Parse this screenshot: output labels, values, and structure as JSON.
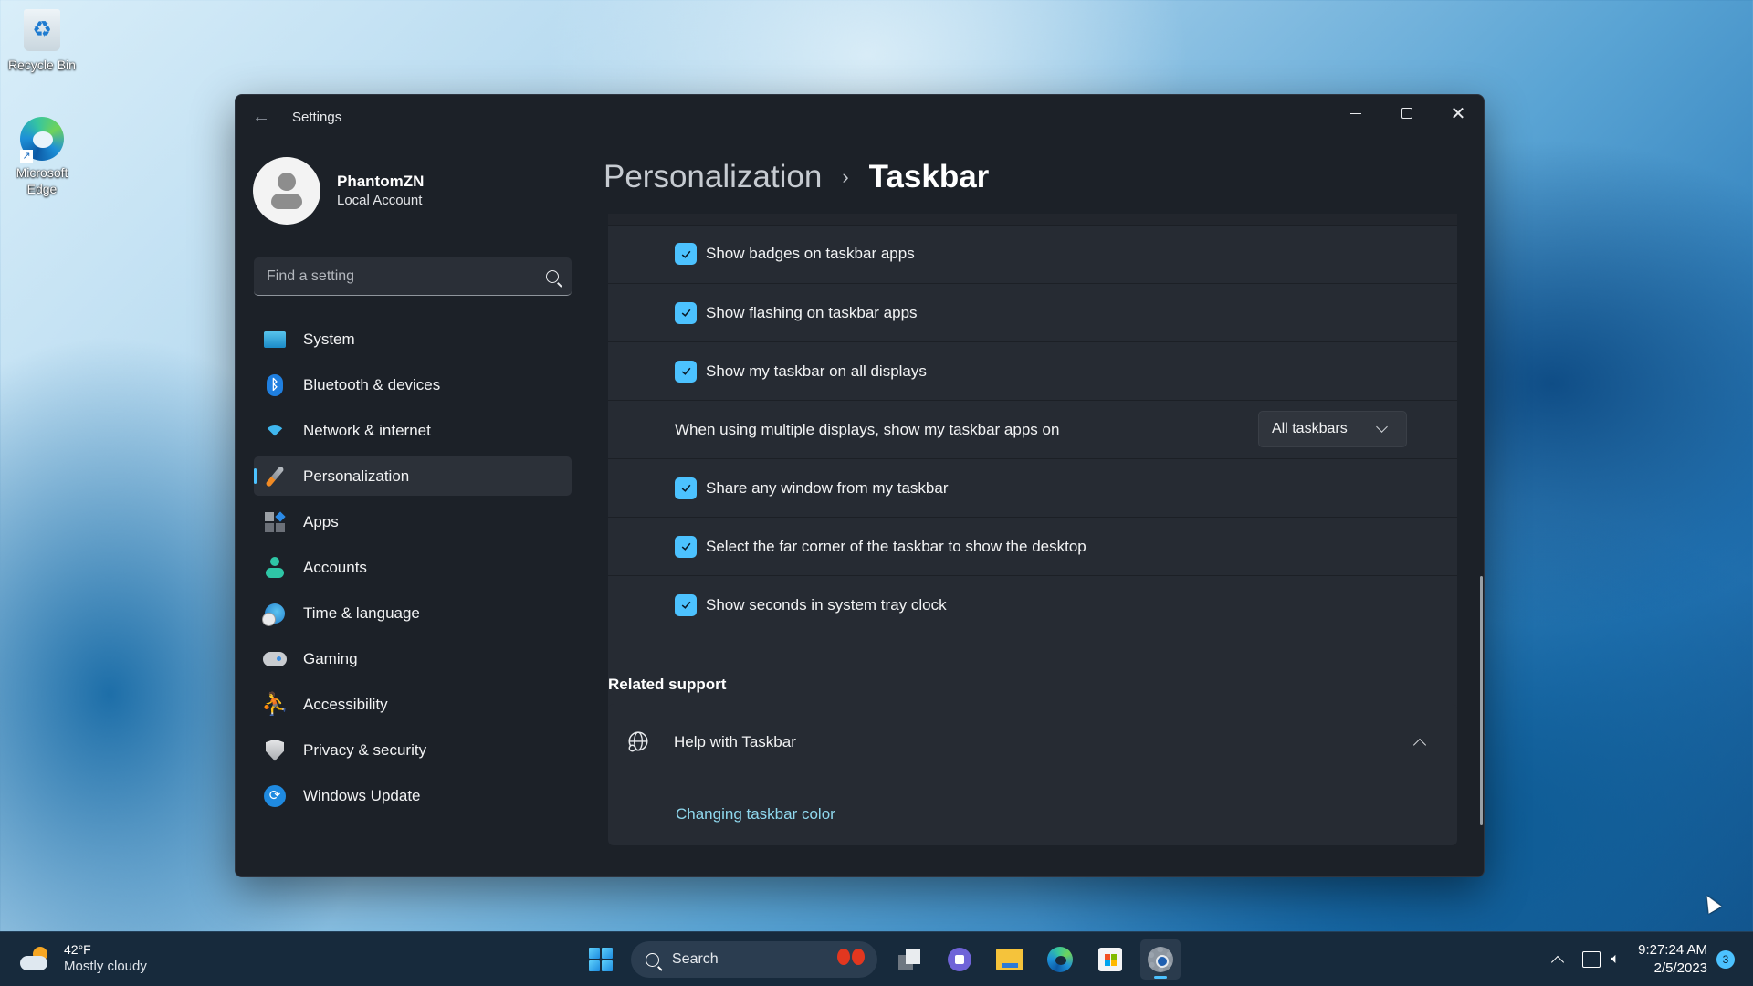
{
  "desktop": {
    "icons": [
      {
        "label": "Recycle Bin",
        "icon": "recycle-bin-icon"
      },
      {
        "label": "Microsoft Edge",
        "icon": "edge-icon"
      }
    ]
  },
  "window": {
    "title": "Settings",
    "controls": {
      "minimize": "minimize",
      "maximize": "maximize",
      "close": "close"
    }
  },
  "profile": {
    "name": "PhantomZN",
    "account_type": "Local Account"
  },
  "search": {
    "placeholder": "Find a setting",
    "value": ""
  },
  "sidebar": {
    "selected": "Personalization",
    "items": [
      {
        "label": "System",
        "icon": "system-icon"
      },
      {
        "label": "Bluetooth & devices",
        "icon": "bluetooth-icon"
      },
      {
        "label": "Network & internet",
        "icon": "wifi-icon"
      },
      {
        "label": "Personalization",
        "icon": "brush-icon"
      },
      {
        "label": "Apps",
        "icon": "apps-icon"
      },
      {
        "label": "Accounts",
        "icon": "accounts-icon"
      },
      {
        "label": "Time & language",
        "icon": "time-language-icon"
      },
      {
        "label": "Gaming",
        "icon": "gamepad-icon"
      },
      {
        "label": "Accessibility",
        "icon": "accessibility-icon"
      },
      {
        "label": "Privacy & security",
        "icon": "shield-icon"
      },
      {
        "label": "Windows Update",
        "icon": "update-icon"
      }
    ]
  },
  "breadcrumb": {
    "parent": "Personalization",
    "separator": "›",
    "current": "Taskbar"
  },
  "settings": {
    "rows": [
      {
        "label": "Show badges on taskbar apps",
        "checked": true
      },
      {
        "label": "Show flashing on taskbar apps",
        "checked": true
      },
      {
        "label": "Show my taskbar on all displays",
        "checked": true
      },
      {
        "label": "When using multiple displays, show my taskbar apps on",
        "dropdown_value": "All taskbars"
      },
      {
        "label": "Share any window from my taskbar",
        "checked": true
      },
      {
        "label": "Select the far corner of the taskbar to show the desktop",
        "checked": true
      },
      {
        "label": "Show seconds in system tray clock",
        "checked": true
      }
    ]
  },
  "related_support": {
    "title": "Related support",
    "help_title": "Help with Taskbar",
    "expanded": true,
    "links": [
      "Changing taskbar color"
    ]
  },
  "taskbar": {
    "weather": {
      "temp": "42°F",
      "condition": "Mostly cloudy"
    },
    "search_label": "Search",
    "apps": [
      "Start",
      "Task View",
      "Teams Chat",
      "File Explorer",
      "Microsoft Edge",
      "Microsoft Store",
      "Settings"
    ],
    "active_app": "Settings",
    "clock": {
      "time": "9:27:24 AM",
      "date": "2/5/2023"
    },
    "notification_count": "3"
  },
  "colors": {
    "accent": "#4cc2ff",
    "window_bg": "#1c2128",
    "card_bg": "#262b33",
    "link": "#8fd8ee"
  }
}
